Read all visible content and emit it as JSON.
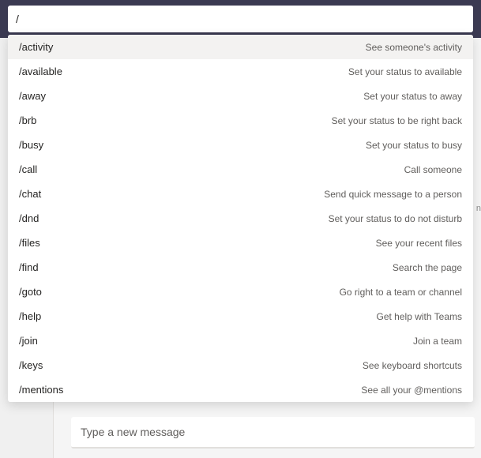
{
  "search": {
    "value": "/"
  },
  "commands": [
    {
      "name": "/activity",
      "desc": "See someone's activity"
    },
    {
      "name": "/available",
      "desc": "Set your status to available"
    },
    {
      "name": "/away",
      "desc": "Set your status to away"
    },
    {
      "name": "/brb",
      "desc": "Set your status to be right back"
    },
    {
      "name": "/busy",
      "desc": "Set your status to busy"
    },
    {
      "name": "/call",
      "desc": "Call someone"
    },
    {
      "name": "/chat",
      "desc": "Send quick message to a person"
    },
    {
      "name": "/dnd",
      "desc": "Set your status to do not disturb"
    },
    {
      "name": "/files",
      "desc": "See your recent files"
    },
    {
      "name": "/find",
      "desc": "Search the page"
    },
    {
      "name": "/goto",
      "desc": "Go right to a team or channel"
    },
    {
      "name": "/help",
      "desc": "Get help with Teams"
    },
    {
      "name": "/join",
      "desc": "Join a team"
    },
    {
      "name": "/keys",
      "desc": "See keyboard shortcuts"
    },
    {
      "name": "/mentions",
      "desc": "See all your @mentions"
    }
  ],
  "compose": {
    "placeholder": "Type a new message"
  },
  "edge_char": "n"
}
